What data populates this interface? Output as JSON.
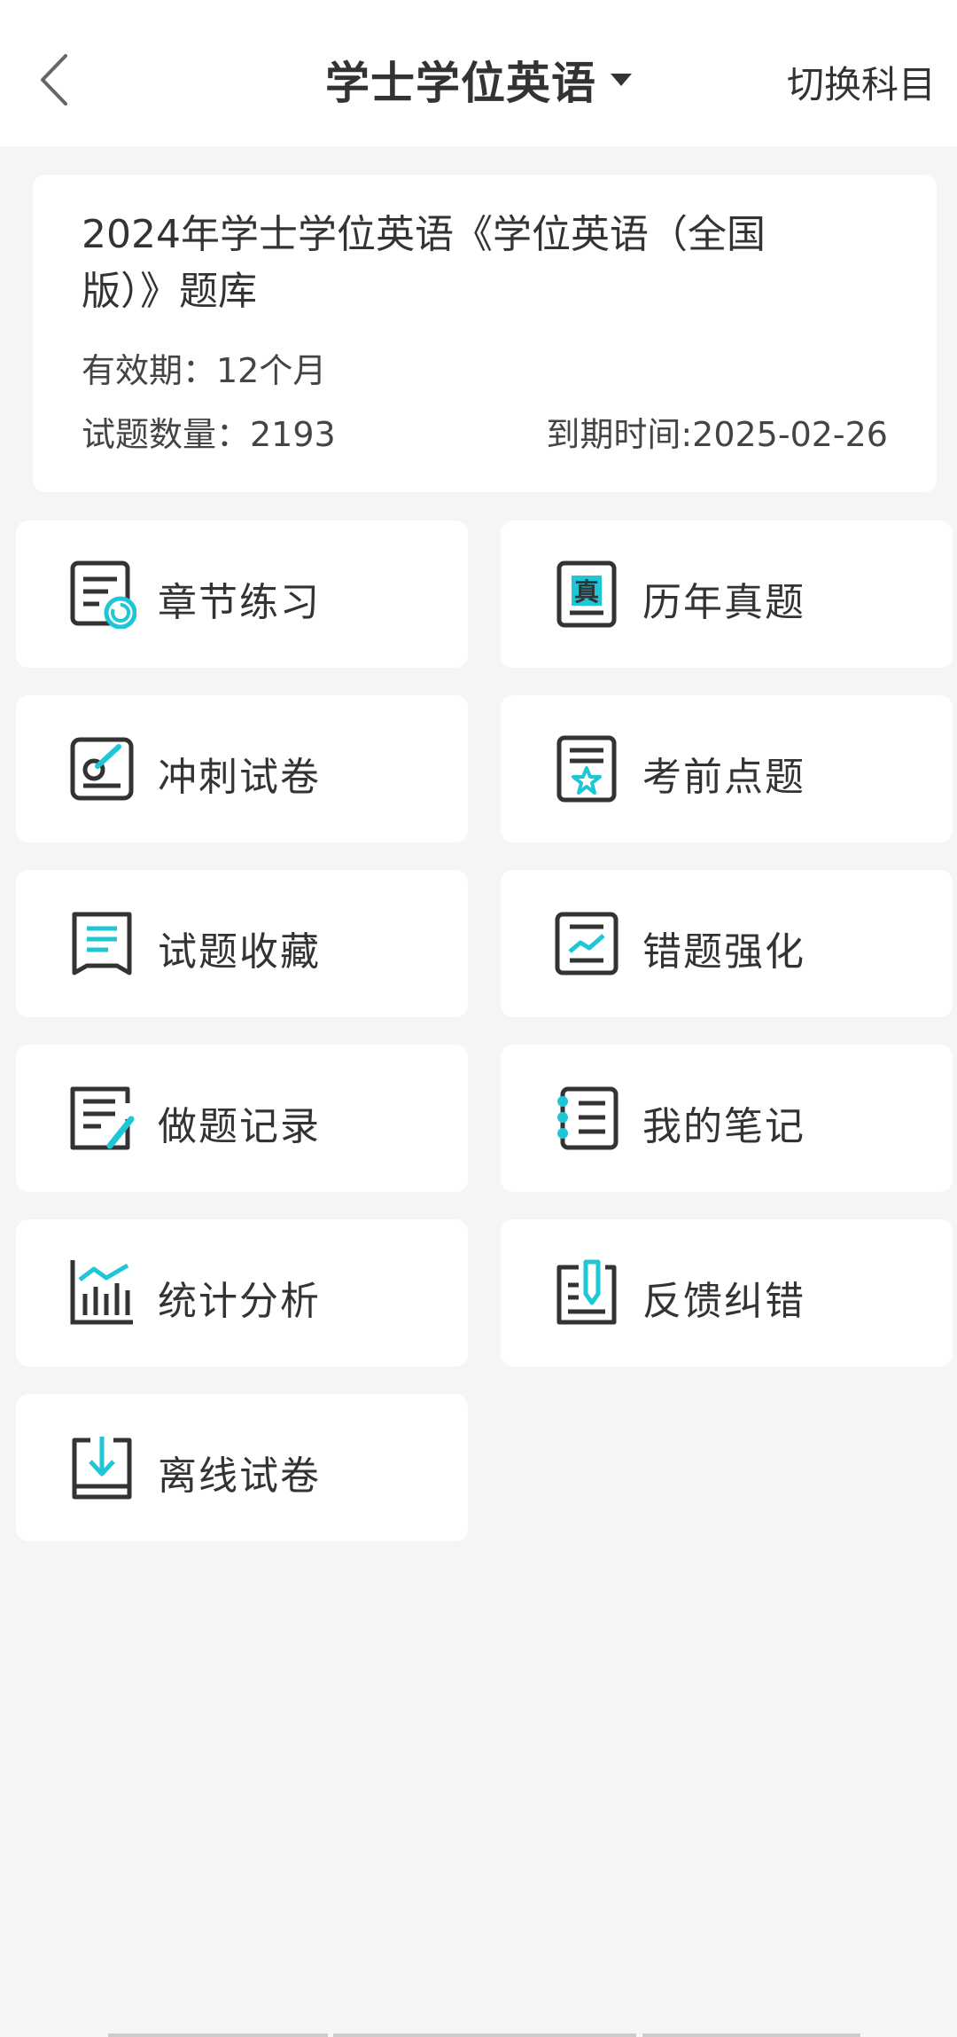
{
  "header": {
    "title": "学士学位英语",
    "switch_label": "切换科目"
  },
  "info": {
    "title": "2024年学士学位英语《学位英语（全国版）》题库",
    "validity": "有效期：12个月",
    "question_count": "试题数量：2193",
    "expiry": "到期时间:2025-02-26"
  },
  "menu": [
    {
      "label": "章节练习",
      "icon": "chapter-practice-icon"
    },
    {
      "label": "历年真题",
      "icon": "past-exams-icon"
    },
    {
      "label": "冲刺试卷",
      "icon": "sprint-paper-icon"
    },
    {
      "label": "考前点题",
      "icon": "pre-exam-tips-icon"
    },
    {
      "label": "试题收藏",
      "icon": "favorites-icon"
    },
    {
      "label": "错题强化",
      "icon": "wrong-questions-icon"
    },
    {
      "label": "做题记录",
      "icon": "practice-record-icon"
    },
    {
      "label": "我的笔记",
      "icon": "notes-icon"
    },
    {
      "label": "统计分析",
      "icon": "statistics-icon"
    },
    {
      "label": "反馈纠错",
      "icon": "feedback-icon"
    },
    {
      "label": "离线试卷",
      "icon": "offline-paper-icon"
    }
  ],
  "colors": {
    "accent": "#1ec6d6",
    "icon_stroke": "#333333"
  }
}
